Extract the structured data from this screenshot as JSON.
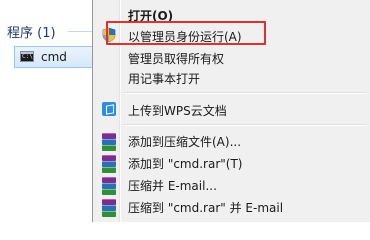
{
  "results": {
    "group_header": "程序 (1)",
    "item_label": "cmd",
    "item_icon": "cmd-icon"
  },
  "menu": {
    "items": [
      {
        "label": "打开(O)",
        "icon": null,
        "bold": true
      },
      {
        "label": "以管理员身份运行(A)",
        "icon": "shield-icon"
      },
      {
        "label": "管理员取得所有权",
        "icon": null
      },
      {
        "label": "用记事本打开",
        "icon": null
      },
      {
        "label": "上传到WPS云文档",
        "icon": "wps-cube-icon"
      },
      {
        "label": "添加到压缩文件(A)...",
        "icon": "winrar-icon"
      },
      {
        "label": "添加到 \"cmd.rar\"(T)",
        "icon": "winrar-icon"
      },
      {
        "label": "压缩并 E-mail...",
        "icon": "winrar-icon"
      },
      {
        "label": "压缩到 \"cmd.rar\" 并 E-mail",
        "icon": "winrar-icon"
      }
    ],
    "highlight_color": "#e0312f"
  }
}
